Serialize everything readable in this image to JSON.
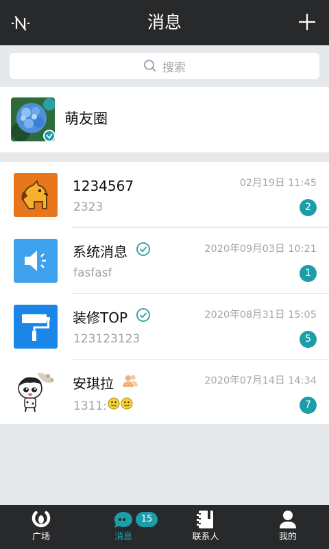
{
  "header": {
    "title": "消息",
    "left_icon": "no-signal-icon",
    "right_icon": "plus-icon"
  },
  "search": {
    "placeholder": "搜索",
    "icon": "search-icon"
  },
  "moments": {
    "label": "萌友圈",
    "avatar": "hydrangea-photo"
  },
  "conversations": [
    {
      "name": "1234567",
      "preview": "2323",
      "time": "02月19日 11:45",
      "unread": "2",
      "verified": false,
      "group": false
    },
    {
      "name": "系统消息",
      "preview": "fasfasf",
      "time": "2020年09月03日 10:21",
      "unread": "1",
      "verified": true,
      "group": false
    },
    {
      "name": "装修TOP",
      "preview": "123123123",
      "time": "2020年08月31日 15:05",
      "unread": "5",
      "verified": true,
      "group": false
    },
    {
      "name": "安琪拉",
      "preview": "1311:",
      "time": "2020年07月14日 14:34",
      "unread": "7",
      "verified": false,
      "group": true
    }
  ],
  "tabbar": {
    "items": [
      {
        "label": "广场",
        "icon": "plaza-icon",
        "active": false
      },
      {
        "label": "消息",
        "icon": "chat-icon",
        "active": true,
        "badge": "15"
      },
      {
        "label": "联系人",
        "icon": "contacts-book-icon",
        "active": false
      },
      {
        "label": "我的",
        "icon": "person-icon",
        "active": false
      }
    ]
  },
  "colors": {
    "header_bg": "#27292b",
    "accent": "#1d9da9",
    "page_bg": "#e6e9ec"
  }
}
